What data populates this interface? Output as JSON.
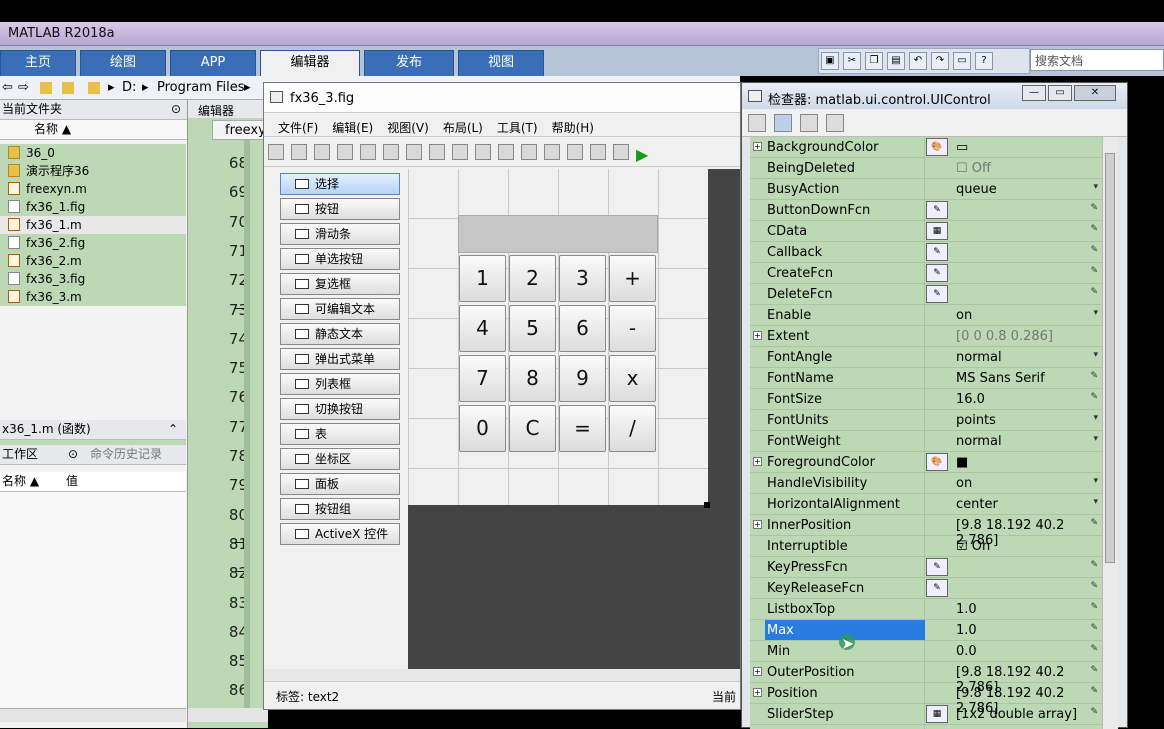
{
  "app": {
    "title": "MATLAB R2018a"
  },
  "ribbon": {
    "tabs": [
      "主页",
      "绘图",
      "APP",
      "编辑器",
      "发布",
      "视图"
    ],
    "active": 3
  },
  "search": {
    "placeholder": "搜索文档"
  },
  "address": {
    "drive": "D:",
    "folder": "Program Files"
  },
  "left": {
    "header": "当前文件夹",
    "col": "名称 ▲",
    "files": [
      {
        "name": "36_0",
        "type": "folder"
      },
      {
        "name": "演示程序36",
        "type": "folder"
      },
      {
        "name": "freexyn.m",
        "type": "m"
      },
      {
        "name": "fx36_1.fig",
        "type": "fig"
      },
      {
        "name": "fx36_1.m",
        "type": "m"
      },
      {
        "name": "fx36_2.fig",
        "type": "fig"
      },
      {
        "name": "fx36_2.m",
        "type": "m"
      },
      {
        "name": "fx36_3.fig",
        "type": "fig"
      },
      {
        "name": "fx36_3.m",
        "type": "m"
      }
    ],
    "detail": "x36_1.m (函数)",
    "ws": "工作区",
    "hist": "命令历史记录",
    "wsname": "名称 ▲",
    "wsval": "值"
  },
  "editor": {
    "title": "编辑器",
    "tab": "freexy",
    "lines": [
      "68",
      "69",
      "70",
      "71",
      "72",
      "73",
      "74",
      "75",
      "76",
      "77",
      "78",
      "79",
      "80",
      "81",
      "82",
      "83",
      "84",
      "85",
      "86"
    ]
  },
  "fig": {
    "title": "fx36_3.fig",
    "menu": [
      "文件(F)",
      "编辑(E)",
      "视图(V)",
      "布局(L)",
      "工具(T)",
      "帮助(H)"
    ],
    "palette": [
      "选择",
      "按钮",
      "滑动条",
      "单选按钮",
      "复选框",
      "可编辑文本",
      "静态文本",
      "弹出式菜单",
      "列表框",
      "切换按钮",
      "表",
      "坐标区",
      "面板",
      "按钮组",
      "ActiveX 控件"
    ],
    "keys": [
      "1",
      "2",
      "3",
      "+",
      "4",
      "5",
      "6",
      "-",
      "7",
      "8",
      "9",
      "x",
      "0",
      "C",
      "=",
      "/"
    ],
    "status": "标签: text2",
    "status_right": "当前"
  },
  "inspector": {
    "title": "检查器: matlab.ui.control.UIControl",
    "props": [
      {
        "name": "BackgroundColor",
        "exp": true,
        "btn": "🎨",
        "val": "▭"
      },
      {
        "name": "BeingDeleted",
        "val": "☐ Off",
        "gray": true
      },
      {
        "name": "BusyAction",
        "val": "queue",
        "dd": "▾"
      },
      {
        "name": "ButtonDownFcn",
        "btn": "✎",
        "dd": "✎"
      },
      {
        "name": "CData",
        "btn": "▦",
        "dd": "✎"
      },
      {
        "name": "Callback",
        "btn": "✎",
        "dd": "✎"
      },
      {
        "name": "CreateFcn",
        "btn": "✎",
        "dd": "✎"
      },
      {
        "name": "DeleteFcn",
        "btn": "✎",
        "dd": "✎"
      },
      {
        "name": "Enable",
        "val": "on",
        "dd": "▾"
      },
      {
        "name": "Extent",
        "exp": true,
        "val": "[0 0 0.8 0.286]",
        "gray": true
      },
      {
        "name": "FontAngle",
        "val": "normal",
        "dd": "▾"
      },
      {
        "name": "FontName",
        "val": "MS Sans Serif",
        "dd": "✎"
      },
      {
        "name": "FontSize",
        "val": "16.0",
        "dd": "✎"
      },
      {
        "name": "FontUnits",
        "val": "points",
        "dd": "▾"
      },
      {
        "name": "FontWeight",
        "val": "normal",
        "dd": "▾"
      },
      {
        "name": "ForegroundColor",
        "exp": true,
        "btn": "🎨",
        "val": "■"
      },
      {
        "name": "HandleVisibility",
        "val": "on",
        "dd": "▾"
      },
      {
        "name": "HorizontalAlignment",
        "val": "center",
        "dd": "▾"
      },
      {
        "name": "InnerPosition",
        "exp": true,
        "val": "[9.8 18.192 40.2 2.786]",
        "dd": "✎"
      },
      {
        "name": "Interruptible",
        "val": "☑ On"
      },
      {
        "name": "KeyPressFcn",
        "btn": "✎",
        "dd": "✎"
      },
      {
        "name": "KeyReleaseFcn",
        "btn": "✎",
        "dd": "✎"
      },
      {
        "name": "ListboxTop",
        "val": "1.0",
        "dd": "✎"
      },
      {
        "name": "Max",
        "val": "1.0",
        "dd": "✎",
        "sel": true
      },
      {
        "name": "Min",
        "val": "0.0",
        "dd": "✎"
      },
      {
        "name": "OuterPosition",
        "exp": true,
        "val": "[9.8 18.192 40.2 2.786]",
        "dd": "✎"
      },
      {
        "name": "Position",
        "exp": true,
        "val": "[9.8 18.192 40.2 2.786]",
        "dd": "✎"
      },
      {
        "name": "SliderStep",
        "btn": "▦",
        "val": "[1x2  double array]",
        "dd": "✎"
      }
    ]
  }
}
